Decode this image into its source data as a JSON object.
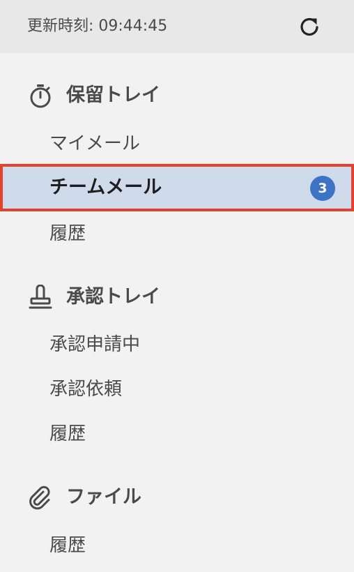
{
  "header": {
    "updated_time": "更新時刻: 09:44:45"
  },
  "sections": [
    {
      "title": "保留トレイ",
      "icon": "stopwatch-icon",
      "items": [
        {
          "label": "マイメール"
        },
        {
          "label": "チームメール",
          "badge": "3",
          "selected": true
        },
        {
          "label": "履歴"
        }
      ]
    },
    {
      "title": "承認トレイ",
      "icon": "stamp-icon",
      "items": [
        {
          "label": "承認申請中"
        },
        {
          "label": "承認依頼"
        },
        {
          "label": "履歴"
        }
      ]
    },
    {
      "title": "ファイル",
      "icon": "paperclip-icon",
      "items": [
        {
          "label": "履歴"
        }
      ]
    }
  ],
  "colors": {
    "selected_background": "#cfdaea",
    "selected_border": "#e5412b",
    "badge": "#3d73c4"
  }
}
